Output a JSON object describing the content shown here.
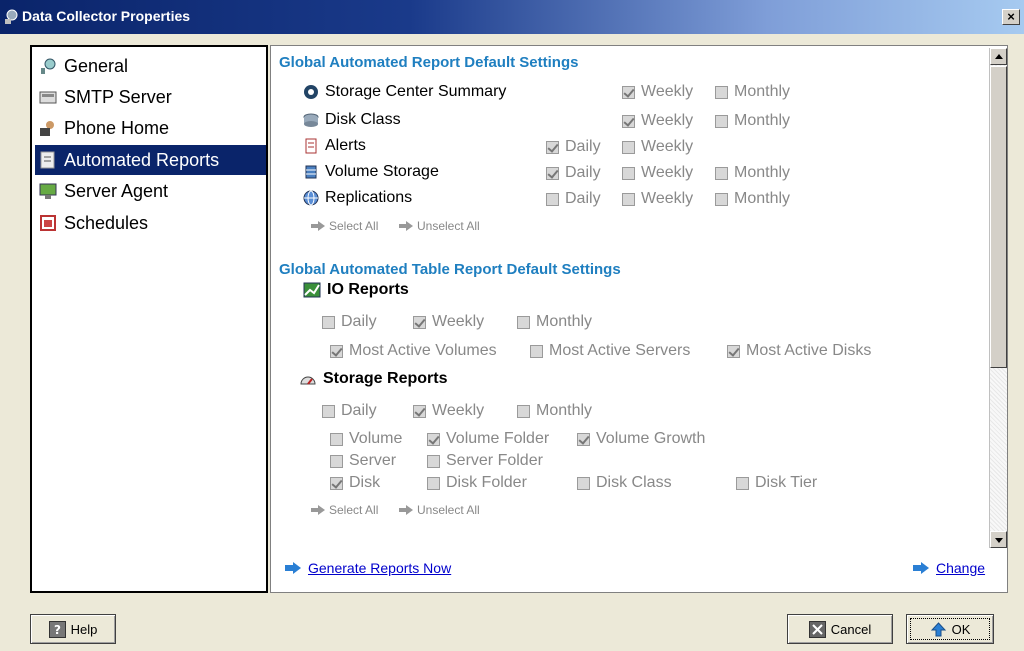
{
  "window": {
    "title": "Data Collector Properties",
    "close_glyph": "×",
    "app_icon": "gear-globe-icon"
  },
  "nav": {
    "items": [
      {
        "label": "General",
        "icon": "general-icon",
        "selected": false
      },
      {
        "label": "SMTP Server",
        "icon": "smtp-icon",
        "selected": false
      },
      {
        "label": "Phone Home",
        "icon": "phone-home-icon",
        "selected": false
      },
      {
        "label": "Automated Reports",
        "icon": "reports-icon",
        "selected": true
      },
      {
        "label": "Server Agent",
        "icon": "server-agent-icon",
        "selected": false
      },
      {
        "label": "Schedules",
        "icon": "schedules-icon",
        "selected": false
      }
    ]
  },
  "reports": {
    "title": "Global Automated Report Default Settings",
    "rows": [
      {
        "label": "Storage Center Summary",
        "icon": "storage-center-icon"
      },
      {
        "label": "Disk Class",
        "icon": "disk-class-icon"
      },
      {
        "label": "Alerts",
        "icon": "alerts-icon"
      },
      {
        "label": "Volume Storage",
        "icon": "volume-storage-icon"
      },
      {
        "label": "Replications",
        "icon": "replications-icon"
      }
    ],
    "options": {
      "daily": "Daily",
      "weekly": "Weekly",
      "monthly": "Monthly"
    },
    "select_all": "Select All",
    "unselect_all": "Unselect All"
  },
  "table_reports": {
    "title": "Global Automated Table Report Default Settings",
    "io": {
      "title": "IO Reports",
      "daily": "Daily",
      "weekly": "Weekly",
      "monthly": "Monthly",
      "most_active_volumes": "Most Active Volumes",
      "most_active_servers": "Most Active Servers",
      "most_active_disks": "Most Active Disks"
    },
    "storage": {
      "title": "Storage Reports",
      "daily": "Daily",
      "weekly": "Weekly",
      "monthly": "Monthly",
      "volume": "Volume",
      "volume_folder": "Volume Folder",
      "volume_growth": "Volume Growth",
      "server": "Server",
      "server_folder": "Server Folder",
      "disk": "Disk",
      "disk_folder": "Disk Folder",
      "disk_class": "Disk Class",
      "disk_tier": "Disk Tier"
    },
    "select_all": "Select All",
    "unselect_all": "Unselect All"
  },
  "links": {
    "generate": "Generate Reports Now",
    "change": "Change"
  },
  "buttons": {
    "help": "Help",
    "cancel": "Cancel",
    "ok": "OK"
  },
  "colors": {
    "section_title": "#1f7fc0",
    "nav_selected": "#0a246a",
    "link": "#0000cc"
  }
}
